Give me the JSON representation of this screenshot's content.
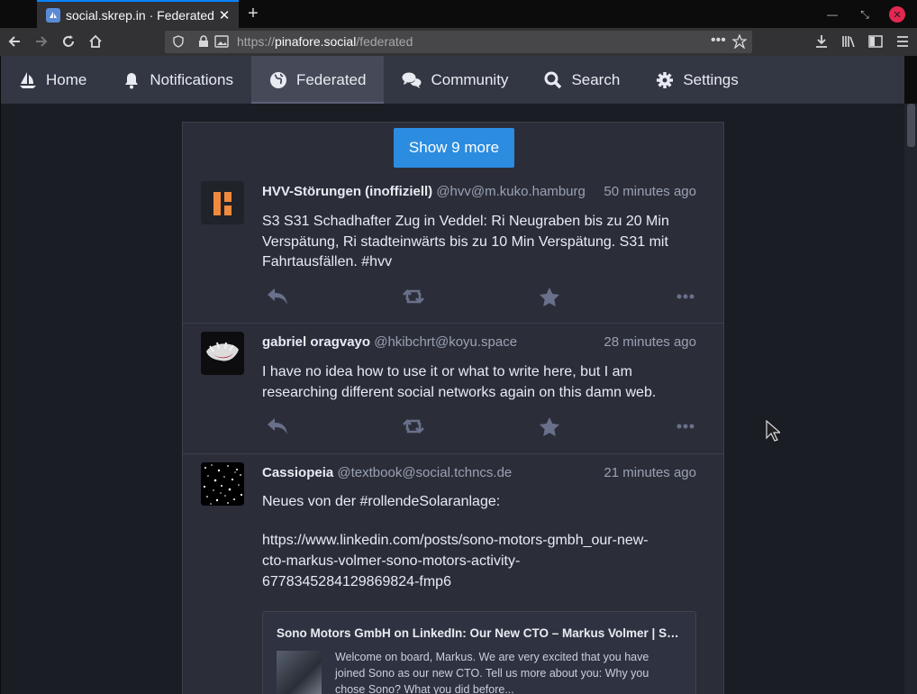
{
  "browser": {
    "tab_title": "social.skrep.in · Federated",
    "url_scheme": "https://",
    "url_host": "pinafore.social",
    "url_path": "/federated"
  },
  "nav": {
    "items": [
      {
        "label": "Home",
        "icon": "sailboat-icon"
      },
      {
        "label": "Notifications",
        "icon": "bell-icon"
      },
      {
        "label": "Federated",
        "icon": "globe-icon",
        "active": true
      },
      {
        "label": "Community",
        "icon": "comments-icon"
      },
      {
        "label": "Search",
        "icon": "search-icon"
      },
      {
        "label": "Settings",
        "icon": "gear-icon"
      }
    ]
  },
  "timeline": {
    "show_more": "Show 9 more",
    "statuses": [
      {
        "display_name": "HVV-Störungen (inoffiziell)",
        "handle": "@hvv@m.kuko.hamburg",
        "time": "50 minutes ago",
        "lines": [
          "S3 S31 Schadhafter Zug in Veddel: Ri Neugraben bis zu 20 Min",
          "Verspätung, Ri stadteinwärts bis zu 10 Min Verspätung. S31 mit",
          "Fahrtausfällen. #hvv"
        ]
      },
      {
        "display_name": "gabriel oragvayo",
        "handle": "@hkibchrt@koyu.space",
        "time": "28 minutes ago",
        "lines": [
          "I have no idea how to use it or what to write here, but I am",
          "researching different social networks again on this damn web."
        ]
      },
      {
        "display_name": "Cassiopeia",
        "handle": "@textbook@social.tchncs.de",
        "time": "21 minutes ago",
        "intro": "Neues von der #rollendeSolaranlage:",
        "link_lines": [
          "https://www.linkedin.com/posts/sono-motors-gmbh_our-new-",
          "cto-markus-volmer-sono-motors-activity-",
          "6778345284129869824-fmp6"
        ],
        "card": {
          "title": "Sono Motors GmbH on LinkedIn: Our New CTO – Markus Volmer | Sono Motors",
          "lines": [
            "Welcome on board, Markus. We are very excited that you have",
            "joined Sono as our new CTO. Tell us more about you: Why you",
            "chose Sono? What you did before..."
          ]
        }
      }
    ]
  },
  "colors": {
    "accent": "#2b8ce0",
    "header_bg": "#333643",
    "main_bg": "#1b1d24",
    "panel_bg": "#2b2e39",
    "hvv_orange": "#f08a3c"
  }
}
